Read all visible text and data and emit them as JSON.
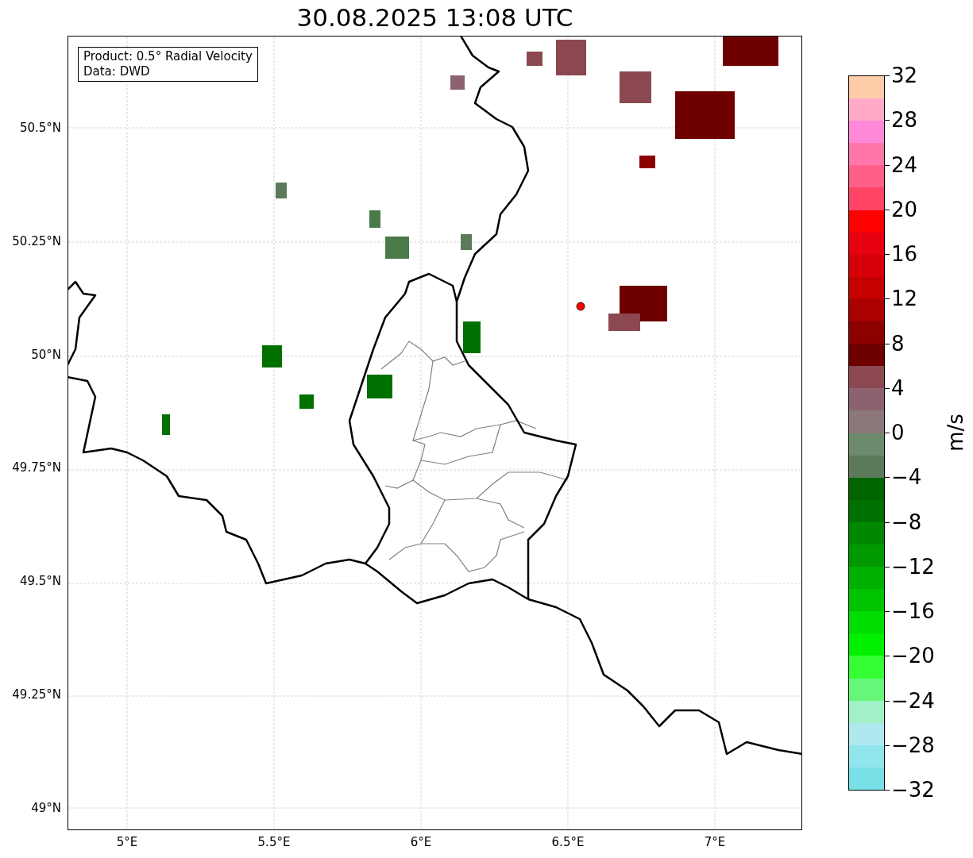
{
  "title": "30.08.2025 13:08 UTC",
  "legend": [
    "Product: 0.5° Radial Velocity",
    "Data: DWD"
  ],
  "lat_labels": [
    "50.5°N",
    "50.25°N",
    "50°N",
    "49.75°N",
    "49.5°N",
    "49.25°N",
    "49°N"
  ],
  "lon_labels": [
    "5°E",
    "5.5°E",
    "6°E",
    "6.5°E",
    "7°E"
  ],
  "colorbar": {
    "label": "m/s",
    "ticks": [
      "32",
      "28",
      "24",
      "20",
      "16",
      "12",
      "8",
      "4",
      "0",
      "−4",
      "−8",
      "−12",
      "−16",
      "−20",
      "−24",
      "−28",
      "−32"
    ],
    "bands": [
      {
        "color": "#ffccaa"
      },
      {
        "color": "#ffaac8"
      },
      {
        "color": "#ff88d8"
      },
      {
        "color": "#ff77aa"
      },
      {
        "color": "#ff5f88"
      },
      {
        "color": "#ff4466"
      },
      {
        "color": "#ff0000"
      },
      {
        "color": "#e60010"
      },
      {
        "color": "#d80008"
      },
      {
        "color": "#c40000"
      },
      {
        "color": "#aa0000"
      },
      {
        "color": "#8c0000"
      },
      {
        "color": "#6e0000"
      },
      {
        "color": "#8c4850"
      },
      {
        "color": "#8c6270"
      },
      {
        "color": "#8c7878"
      },
      {
        "color": "#6c8a6c"
      },
      {
        "color": "#5a7a5a"
      },
      {
        "color": "#006400"
      },
      {
        "color": "#007000"
      },
      {
        "color": "#008800"
      },
      {
        "color": "#009a00"
      },
      {
        "color": "#00b000"
      },
      {
        "color": "#00c400"
      },
      {
        "color": "#00dd00"
      },
      {
        "color": "#00f000"
      },
      {
        "color": "#33ff33"
      },
      {
        "color": "#66f77a"
      },
      {
        "color": "#a0f0c8"
      },
      {
        "color": "#b0e8f0"
      },
      {
        "color": "#90e6ec"
      },
      {
        "color": "#78e0e6"
      }
    ]
  }
}
